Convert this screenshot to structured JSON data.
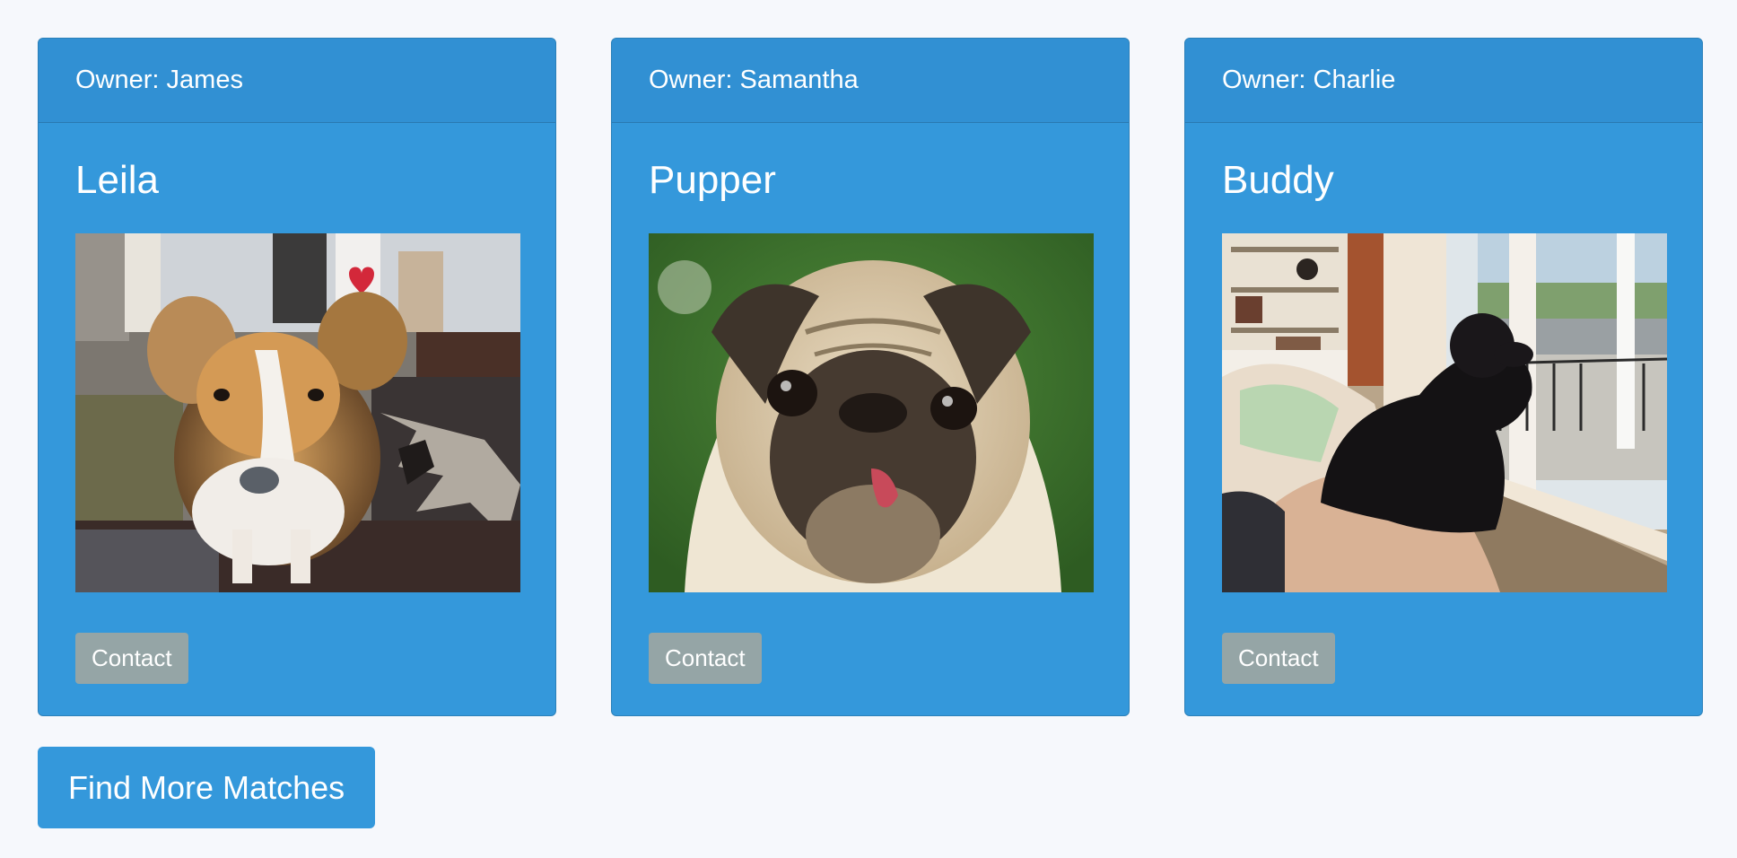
{
  "cards": [
    {
      "owner": "Owner: James",
      "name": "Leila",
      "photo_desc": "dog-photo-sheltie",
      "contact_label": "Contact"
    },
    {
      "owner": "Owner: Samantha",
      "name": "Pupper",
      "photo_desc": "dog-photo-pug",
      "contact_label": "Contact"
    },
    {
      "owner": "Owner: Charlie",
      "name": "Buddy",
      "photo_desc": "dog-photo-black-poodle",
      "contact_label": "Contact"
    }
  ],
  "find_more_label": "Find More Matches",
  "colors": {
    "background": "#f6f8fc",
    "card": "#3498db",
    "card_header": "#3190d3",
    "contact_button": "#95a5a6",
    "text": "#ffffff"
  }
}
